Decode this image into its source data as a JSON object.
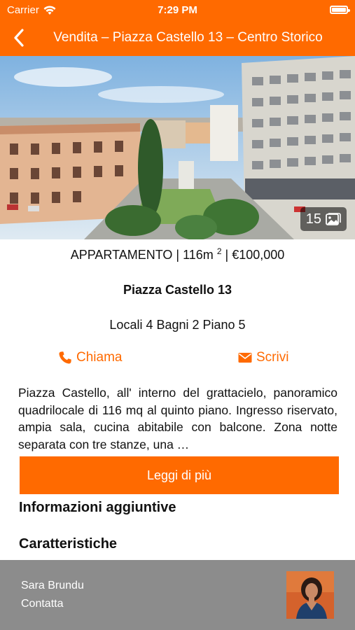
{
  "status_bar": {
    "carrier": "Carrier",
    "time": "7:29 PM"
  },
  "navbar": {
    "title": "Vendita – Piazza Castello 13 – Centro Storico",
    "back_icon": "chevron-left-icon"
  },
  "hero": {
    "photo_count": "15",
    "gallery_icon": "gallery-icon"
  },
  "listing": {
    "type": "APPARTAMENTO",
    "area": "116m",
    "area_exp": "2",
    "price": "€100,000",
    "address": "Piazza Castello 13",
    "rooms": "Locali 4 Bagni 2 Piano 5",
    "description": "Piazza Castello, all' interno del grattacielo, panoramico quadrilocale di 116 mq al quinto piano. Ingresso riservato, ampia sala, cucina abitabile con balcone. Zona notte separata con tre stanze, una …"
  },
  "actions": {
    "call_label": "Chiama",
    "write_label": "Scrivi"
  },
  "buttons": {
    "read_more": "Leggi di più"
  },
  "sections": {
    "additional_info": "Informazioni aggiuntive",
    "features": "Caratteristiche"
  },
  "agent": {
    "name": "Sara Brundu",
    "contact_label": "Contatta"
  },
  "colors": {
    "accent": "#ff6a00",
    "footer": "#8c8c8c"
  }
}
